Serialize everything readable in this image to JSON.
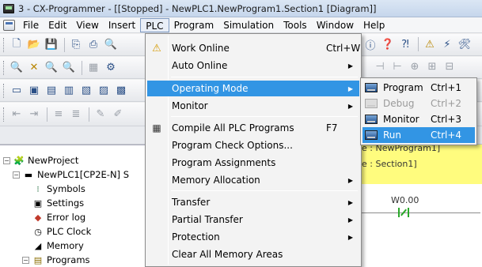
{
  "window": {
    "title": "3 - CX-Programmer - [[Stopped] - NewPLC1.NewProgram1.Section1 [Diagram]]"
  },
  "menubar": [
    "File",
    "Edit",
    "View",
    "Insert",
    "PLC",
    "Program",
    "Simulation",
    "Tools",
    "Window",
    "Help"
  ],
  "plc_menu": {
    "work_online": {
      "label": "Work Online",
      "shortcut": "Ctrl+W"
    },
    "auto_online": {
      "label": "Auto Online"
    },
    "operating_mode": {
      "label": "Operating Mode"
    },
    "monitor": {
      "label": "Monitor"
    },
    "compile_all": {
      "label": "Compile All PLC Programs",
      "shortcut": "F7"
    },
    "program_check": {
      "label": "Program Check Options..."
    },
    "program_assign": {
      "label": "Program Assignments"
    },
    "memory_alloc": {
      "label": "Memory Allocation"
    },
    "transfer": {
      "label": "Transfer"
    },
    "partial_transfer": {
      "label": "Partial Transfer"
    },
    "protection": {
      "label": "Protection"
    },
    "clear_memory": {
      "label": "Clear All Memory Areas"
    }
  },
  "mode_submenu": {
    "program": {
      "label": "Program",
      "shortcut": "Ctrl+1"
    },
    "debug": {
      "label": "Debug",
      "shortcut": "Ctrl+2"
    },
    "monitor": {
      "label": "Monitor",
      "shortcut": "Ctrl+3"
    },
    "run": {
      "label": "Run",
      "shortcut": "Ctrl+4"
    }
  },
  "tree": {
    "project": "NewProject",
    "plc": "NewPLC1[CP2E-N] S",
    "symbols": "Symbols",
    "settings": "Settings",
    "error_log": "Error log",
    "plc_clock": "PLC Clock",
    "memory": "Memory",
    "programs": "Programs"
  },
  "diagram": {
    "program_label": "e : NewProgram1]",
    "section_label": "e : Section1]",
    "contact_address": "W0.00"
  },
  "colors": {
    "highlight": "#3295e4",
    "diagram_header": "#fffc7e",
    "contact": "#2aa82a"
  }
}
